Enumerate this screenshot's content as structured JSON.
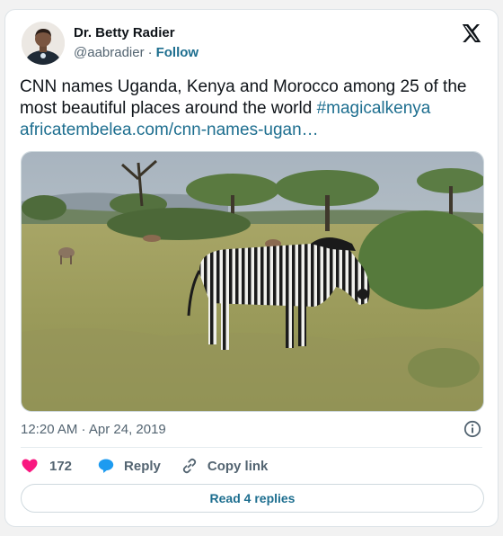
{
  "author": {
    "name": "Dr. Betty Radier",
    "handle": "@aabradier",
    "separator": "·",
    "follow_label": "Follow"
  },
  "tweet": {
    "text": "CNN names Uganda, Kenya and Morocco among 25 of the most beautiful places around the world ",
    "hashtag": "#magicalkenya",
    "link_text": "africatembelea.com/cnn-names-ugan…"
  },
  "meta": {
    "timestamp": "12:20 AM · Apr 24, 2019"
  },
  "actions": {
    "like_count": "172",
    "reply_label": "Reply",
    "copy_link_label": "Copy link"
  },
  "read_replies_label": "Read 4 replies",
  "icons": {
    "logo": "x-logo-icon",
    "like": "heart-icon",
    "reply": "speech-bubble-icon",
    "copy": "link-icon",
    "info": "info-icon"
  },
  "colors": {
    "link": "#1d6e8f",
    "heart": "#f91880",
    "reply_bubble": "#1d9bf0",
    "muted": "#536471"
  }
}
